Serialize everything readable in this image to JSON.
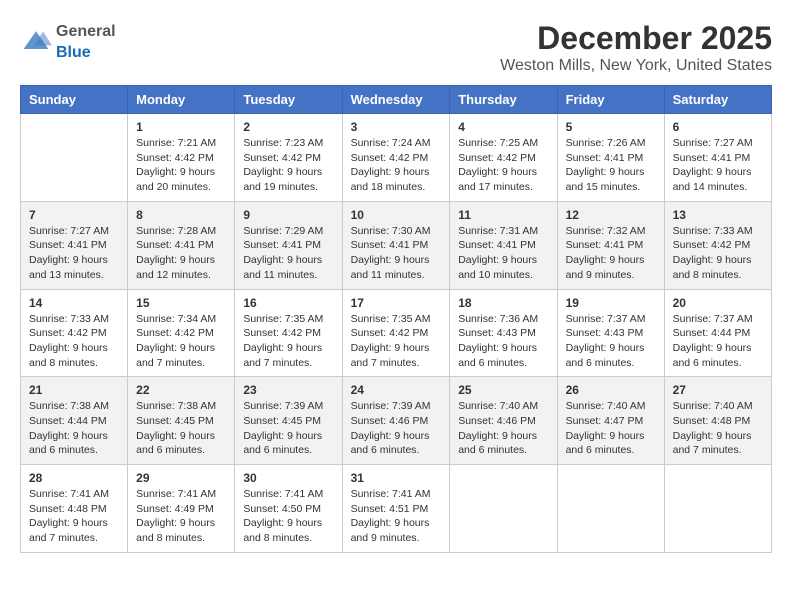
{
  "logo": {
    "general": "General",
    "blue": "Blue"
  },
  "title": {
    "month": "December 2025",
    "location": "Weston Mills, New York, United States"
  },
  "weekdays": [
    "Sunday",
    "Monday",
    "Tuesday",
    "Wednesday",
    "Thursday",
    "Friday",
    "Saturday"
  ],
  "weeks": [
    [
      {
        "day": "",
        "info": ""
      },
      {
        "day": "1",
        "info": "Sunrise: 7:21 AM\nSunset: 4:42 PM\nDaylight: 9 hours\nand 20 minutes."
      },
      {
        "day": "2",
        "info": "Sunrise: 7:23 AM\nSunset: 4:42 PM\nDaylight: 9 hours\nand 19 minutes."
      },
      {
        "day": "3",
        "info": "Sunrise: 7:24 AM\nSunset: 4:42 PM\nDaylight: 9 hours\nand 18 minutes."
      },
      {
        "day": "4",
        "info": "Sunrise: 7:25 AM\nSunset: 4:42 PM\nDaylight: 9 hours\nand 17 minutes."
      },
      {
        "day": "5",
        "info": "Sunrise: 7:26 AM\nSunset: 4:41 PM\nDaylight: 9 hours\nand 15 minutes."
      },
      {
        "day": "6",
        "info": "Sunrise: 7:27 AM\nSunset: 4:41 PM\nDaylight: 9 hours\nand 14 minutes."
      }
    ],
    [
      {
        "day": "7",
        "info": "Sunrise: 7:27 AM\nSunset: 4:41 PM\nDaylight: 9 hours\nand 13 minutes."
      },
      {
        "day": "8",
        "info": "Sunrise: 7:28 AM\nSunset: 4:41 PM\nDaylight: 9 hours\nand 12 minutes."
      },
      {
        "day": "9",
        "info": "Sunrise: 7:29 AM\nSunset: 4:41 PM\nDaylight: 9 hours\nand 11 minutes."
      },
      {
        "day": "10",
        "info": "Sunrise: 7:30 AM\nSunset: 4:41 PM\nDaylight: 9 hours\nand 11 minutes."
      },
      {
        "day": "11",
        "info": "Sunrise: 7:31 AM\nSunset: 4:41 PM\nDaylight: 9 hours\nand 10 minutes."
      },
      {
        "day": "12",
        "info": "Sunrise: 7:32 AM\nSunset: 4:41 PM\nDaylight: 9 hours\nand 9 minutes."
      },
      {
        "day": "13",
        "info": "Sunrise: 7:33 AM\nSunset: 4:42 PM\nDaylight: 9 hours\nand 8 minutes."
      }
    ],
    [
      {
        "day": "14",
        "info": "Sunrise: 7:33 AM\nSunset: 4:42 PM\nDaylight: 9 hours\nand 8 minutes."
      },
      {
        "day": "15",
        "info": "Sunrise: 7:34 AM\nSunset: 4:42 PM\nDaylight: 9 hours\nand 7 minutes."
      },
      {
        "day": "16",
        "info": "Sunrise: 7:35 AM\nSunset: 4:42 PM\nDaylight: 9 hours\nand 7 minutes."
      },
      {
        "day": "17",
        "info": "Sunrise: 7:35 AM\nSunset: 4:42 PM\nDaylight: 9 hours\nand 7 minutes."
      },
      {
        "day": "18",
        "info": "Sunrise: 7:36 AM\nSunset: 4:43 PM\nDaylight: 9 hours\nand 6 minutes."
      },
      {
        "day": "19",
        "info": "Sunrise: 7:37 AM\nSunset: 4:43 PM\nDaylight: 9 hours\nand 6 minutes."
      },
      {
        "day": "20",
        "info": "Sunrise: 7:37 AM\nSunset: 4:44 PM\nDaylight: 9 hours\nand 6 minutes."
      }
    ],
    [
      {
        "day": "21",
        "info": "Sunrise: 7:38 AM\nSunset: 4:44 PM\nDaylight: 9 hours\nand 6 minutes."
      },
      {
        "day": "22",
        "info": "Sunrise: 7:38 AM\nSunset: 4:45 PM\nDaylight: 9 hours\nand 6 minutes."
      },
      {
        "day": "23",
        "info": "Sunrise: 7:39 AM\nSunset: 4:45 PM\nDaylight: 9 hours\nand 6 minutes."
      },
      {
        "day": "24",
        "info": "Sunrise: 7:39 AM\nSunset: 4:46 PM\nDaylight: 9 hours\nand 6 minutes."
      },
      {
        "day": "25",
        "info": "Sunrise: 7:40 AM\nSunset: 4:46 PM\nDaylight: 9 hours\nand 6 minutes."
      },
      {
        "day": "26",
        "info": "Sunrise: 7:40 AM\nSunset: 4:47 PM\nDaylight: 9 hours\nand 6 minutes."
      },
      {
        "day": "27",
        "info": "Sunrise: 7:40 AM\nSunset: 4:48 PM\nDaylight: 9 hours\nand 7 minutes."
      }
    ],
    [
      {
        "day": "28",
        "info": "Sunrise: 7:41 AM\nSunset: 4:48 PM\nDaylight: 9 hours\nand 7 minutes."
      },
      {
        "day": "29",
        "info": "Sunrise: 7:41 AM\nSunset: 4:49 PM\nDaylight: 9 hours\nand 8 minutes."
      },
      {
        "day": "30",
        "info": "Sunrise: 7:41 AM\nSunset: 4:50 PM\nDaylight: 9 hours\nand 8 minutes."
      },
      {
        "day": "31",
        "info": "Sunrise: 7:41 AM\nSunset: 4:51 PM\nDaylight: 9 hours\nand 9 minutes."
      },
      {
        "day": "",
        "info": ""
      },
      {
        "day": "",
        "info": ""
      },
      {
        "day": "",
        "info": ""
      }
    ]
  ]
}
